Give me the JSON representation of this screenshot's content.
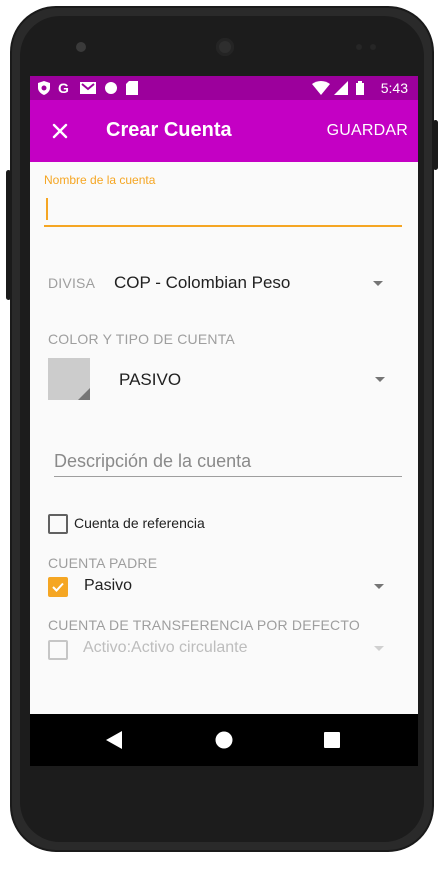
{
  "status_bar": {
    "icons": [
      "shield-icon",
      "google-icon",
      "gmail-icon",
      "circle-icon",
      "sd-card-icon"
    ],
    "right_icons": [
      "wifi-icon",
      "signal-icon",
      "battery-icon"
    ],
    "time": "5:43"
  },
  "appbar": {
    "close_icon": "close-icon",
    "title": "Crear Cuenta",
    "save_label": "GUARDAR"
  },
  "form": {
    "name_label": "Nombre de la cuenta",
    "name_value": "",
    "currency_label": "DIVISA",
    "currency_value": "COP - Colombian Peso",
    "color_type_label": "COLOR Y TIPO DE CUENTA",
    "account_type_value": "PASIVO",
    "description_placeholder": "Descripción de la cuenta",
    "reference_account_label": "Cuenta de referencia",
    "reference_account_checked": false,
    "parent_account_label": "CUENTA PADRE",
    "parent_account_checked": true,
    "parent_account_value": "Pasivo",
    "default_transfer_label": "CUENTA DE TRANSFERENCIA POR DEFECTO",
    "default_transfer_checked": false,
    "default_transfer_value": "Activo:Activo circulante"
  },
  "colors": {
    "status_bar": "#9c009c",
    "appbar": "#c400c4",
    "accent": "#f5a623",
    "swatch": "#cccccc"
  },
  "navigation": {
    "back_icon": "back-triangle-icon",
    "home_icon": "home-circle-icon",
    "recents_icon": "recents-square-icon"
  }
}
